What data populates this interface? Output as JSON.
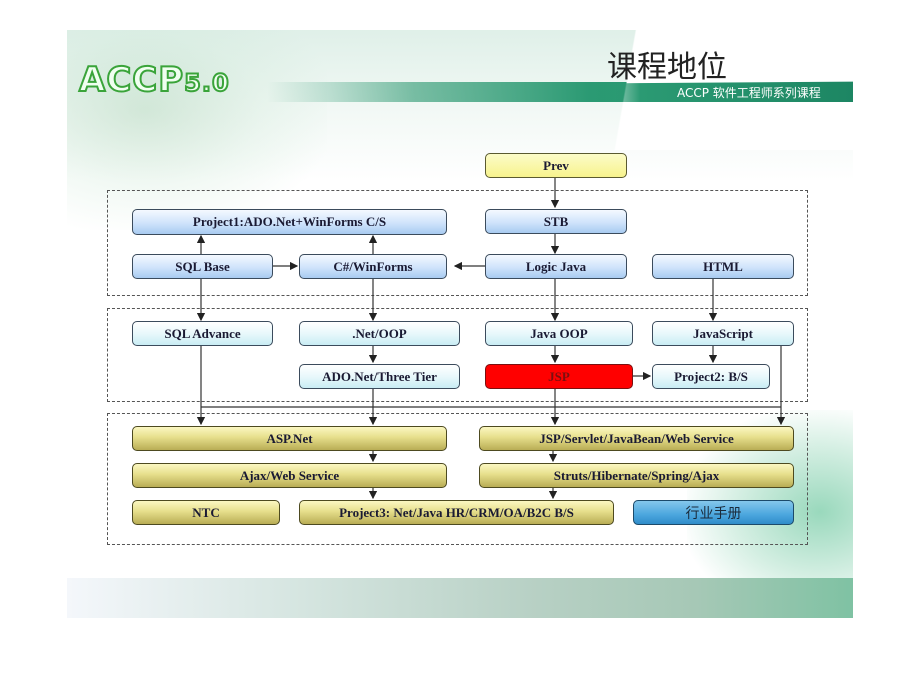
{
  "header": {
    "logo_text": "ACCP",
    "logo_version": "5.0",
    "title": "课程地位",
    "subtitle": "ACCP 软件工程师系列课程"
  },
  "diagram": {
    "nodes": {
      "prev": "Prev",
      "project1": "Project1:ADO.Net+WinForms C/S",
      "stb": "STB",
      "sql_base": "SQL Base",
      "csharp_winforms": "C#/WinForms",
      "logic_java": "Logic Java",
      "html": "HTML",
      "sql_advance": "SQL Advance",
      "net_oop": ".Net/OOP",
      "java_oop": "Java OOP",
      "javascript": "JavaScript",
      "ado_three_tier": "ADO.Net/Three Tier",
      "jsp": "JSP",
      "project2": "Project2: B/S",
      "asp_net": "ASP.Net",
      "jsp_servlet": "JSP/Servlet/JavaBean/Web Service",
      "ajax_ws": "Ajax/Web Service",
      "struts": "Struts/Hibernate/Spring/Ajax",
      "ntc": "NTC",
      "project3": "Project3: Net/Java HR/CRM/OA/B2C B/S",
      "industry_manual": "行业手册"
    },
    "edges": [
      [
        "prev",
        "stb"
      ],
      [
        "stb",
        "logic_java"
      ],
      [
        "logic_java",
        "csharp_winforms"
      ],
      [
        "sql_base",
        "csharp_winforms"
      ],
      [
        "sql_base",
        "project1"
      ],
      [
        "csharp_winforms",
        "project1"
      ],
      [
        "sql_base",
        "sql_advance"
      ],
      [
        "csharp_winforms",
        "net_oop"
      ],
      [
        "logic_java",
        "java_oop"
      ],
      [
        "html",
        "javascript"
      ],
      [
        "net_oop",
        "ado_three_tier"
      ],
      [
        "java_oop",
        "jsp"
      ],
      [
        "javascript",
        "project2"
      ],
      [
        "jsp",
        "project2"
      ],
      [
        "sql_advance",
        "asp_net"
      ],
      [
        "ado_three_tier",
        "asp_net"
      ],
      [
        "jsp",
        "jsp_servlet"
      ],
      [
        "javascript",
        "jsp_servlet"
      ],
      [
        "asp_net",
        "ajax_ws"
      ],
      [
        "ajax_ws",
        "project3"
      ],
      [
        "jsp_servlet",
        "struts"
      ],
      [
        "struts",
        "project3"
      ]
    ],
    "highlight_color": "#ff0000"
  }
}
